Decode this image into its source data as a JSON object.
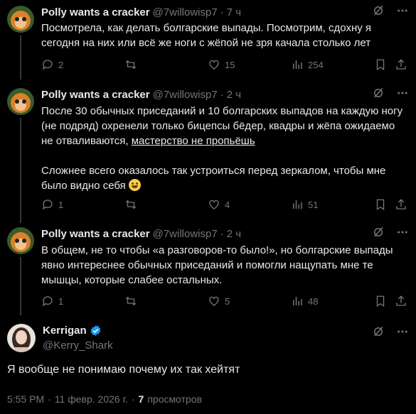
{
  "tweets": [
    {
      "name": "Polly wants a cracker",
      "handle": "@7willowisp7",
      "dot": "·",
      "time": "7 ч",
      "text": "Посмотрела, как делать болгарские выпады. Посмотрим, сдохну я сегодня на них или всё же ноги с жёпой не зря качала столько лет",
      "replies": "2",
      "retweets": "",
      "likes": "15",
      "views": "254"
    },
    {
      "name": "Polly wants a cracker",
      "handle": "@7willowisp7",
      "dot": "·",
      "time": "2 ч",
      "text_part1": "После 30 обычных приседаний и 10 болгарских выпадов на каждую ногу (не подряд) охренели только бицепсы бёдер, квадры и жёпа ожидаемо не отваливаются,",
      "text_link": "мастерство не пропьёшь",
      "text_part2": "Сложнее всего оказалось так устроиться перед зеркалом, чтобы мне было видно себя",
      "replies": "1",
      "retweets": "",
      "likes": "4",
      "views": "51"
    },
    {
      "name": "Polly wants a cracker",
      "handle": "@7willowisp7",
      "dot": "·",
      "time": "2 ч",
      "text": "В общем, не то чтобы «а разговоров-то было!», но болгарские выпады явно интереснее обычных приседаний и помогли нащупать мне те мышцы, которые слабее остальных.",
      "replies": "1",
      "retweets": "",
      "likes": "5",
      "views": "48"
    }
  ],
  "main": {
    "name": "Kerrigan",
    "handle": "@Kerry_Shark",
    "text": "Я вообще не понимаю почему их так хейтят",
    "time": "5:55 PM",
    "date": "11 февр. 2026 г.",
    "dot": "·",
    "views_count": "7",
    "views_label": "просмотров"
  },
  "colors": {
    "background": "#000000",
    "text": "#e7e9ea",
    "muted": "#71767b",
    "verified": "#1d9bf0"
  },
  "icons": [
    "grok-icon",
    "more-icon",
    "reply-icon",
    "retweet-icon",
    "like-icon",
    "views-icon",
    "bookmark-icon",
    "share-icon",
    "verified-icon",
    "emoji-grinning"
  ]
}
